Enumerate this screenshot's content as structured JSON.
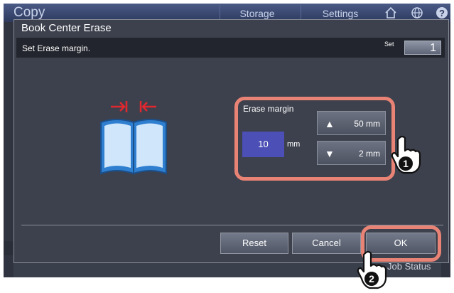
{
  "background": {
    "app_title": "Copy",
    "tabs": [
      "Storage",
      "Settings"
    ],
    "job_status": "Job Status"
  },
  "dialog": {
    "title": "Book Center Erase",
    "instruction": "Set Erase margin.",
    "set_label": "Set",
    "set_value": "1"
  },
  "erase_margin": {
    "label": "Erase margin",
    "value": "10",
    "unit": "mm",
    "max_label": "50 mm",
    "min_label": "2 mm"
  },
  "footer": {
    "reset_label": "Reset",
    "cancel_label": "Cancel",
    "ok_label": "OK"
  },
  "callouts": {
    "step1": "1",
    "step2": "2"
  },
  "colors": {
    "highlight": "#e98375",
    "value_box": "#4b4fb6",
    "book_blue": "#2f7fd0",
    "arrow_red": "#e0282f"
  },
  "icons": [
    "home-icon",
    "globe-icon",
    "help-icon",
    "book-icon",
    "arrow-up-icon",
    "arrow-down-icon",
    "pointing-hand-icon"
  ]
}
